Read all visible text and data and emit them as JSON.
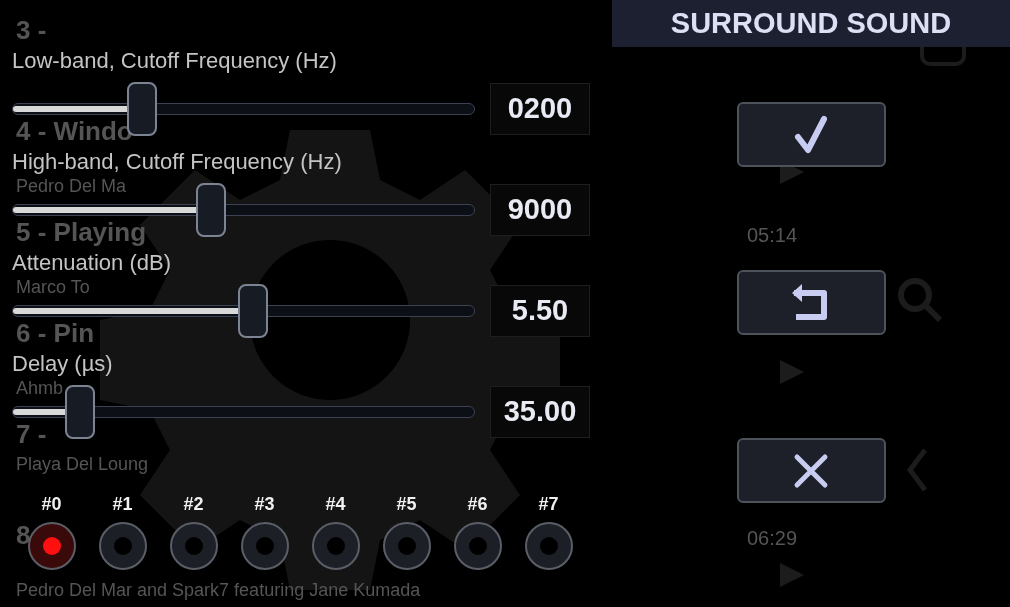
{
  "background_list": {
    "rows": [
      {
        "title": "3 -",
        "lines": [],
        "time": ""
      },
      {
        "title": "4 - Windo",
        "lines": [
          {
            "kind": "artist",
            "text": "Pedro Del Ma"
          }
        ],
        "time": ""
      },
      {
        "title": "5 - Playing",
        "lines": [
          {
            "kind": "artist",
            "text": "Marco To"
          }
        ],
        "time": "05:14"
      },
      {
        "title": "6 - Pin",
        "lines": [
          {
            "kind": "artist",
            "text": "Ahmb"
          }
        ],
        "time": ""
      },
      {
        "title": "7 -",
        "lines": [
          {
            "kind": "album",
            "text": "Playa Del Loung"
          }
        ],
        "time": ""
      },
      {
        "title": "8",
        "lines": [
          {
            "kind": "artist",
            "text": "Pedro Del Mar and Spark7 featuring Jane Kumada"
          }
        ],
        "time": "06:29"
      }
    ]
  },
  "dialog": {
    "title": "SURROUND SOUND",
    "sliders": [
      {
        "label": "Low-band, Cutoff Frequency (Hz)",
        "level": 0.28,
        "value": "0200"
      },
      {
        "label": "High-band, Cutoff Frequency (Hz)",
        "level": 0.43,
        "value": "9000"
      },
      {
        "label": "Attenuation (dB)",
        "level": 0.52,
        "value": "5.50"
      },
      {
        "label": "Delay (µs)",
        "level": 0.147,
        "value": "35.00"
      }
    ],
    "channels": [
      {
        "label": "#0",
        "selected": true
      },
      {
        "label": "#1",
        "selected": false
      },
      {
        "label": "#2",
        "selected": false
      },
      {
        "label": "#3",
        "selected": false
      },
      {
        "label": "#4",
        "selected": false
      },
      {
        "label": "#5",
        "selected": false
      },
      {
        "label": "#6",
        "selected": false
      },
      {
        "label": "#7",
        "selected": false
      }
    ],
    "buttons": [
      {
        "kind": "ok"
      },
      {
        "kind": "reset"
      },
      {
        "kind": "cancel"
      }
    ]
  }
}
